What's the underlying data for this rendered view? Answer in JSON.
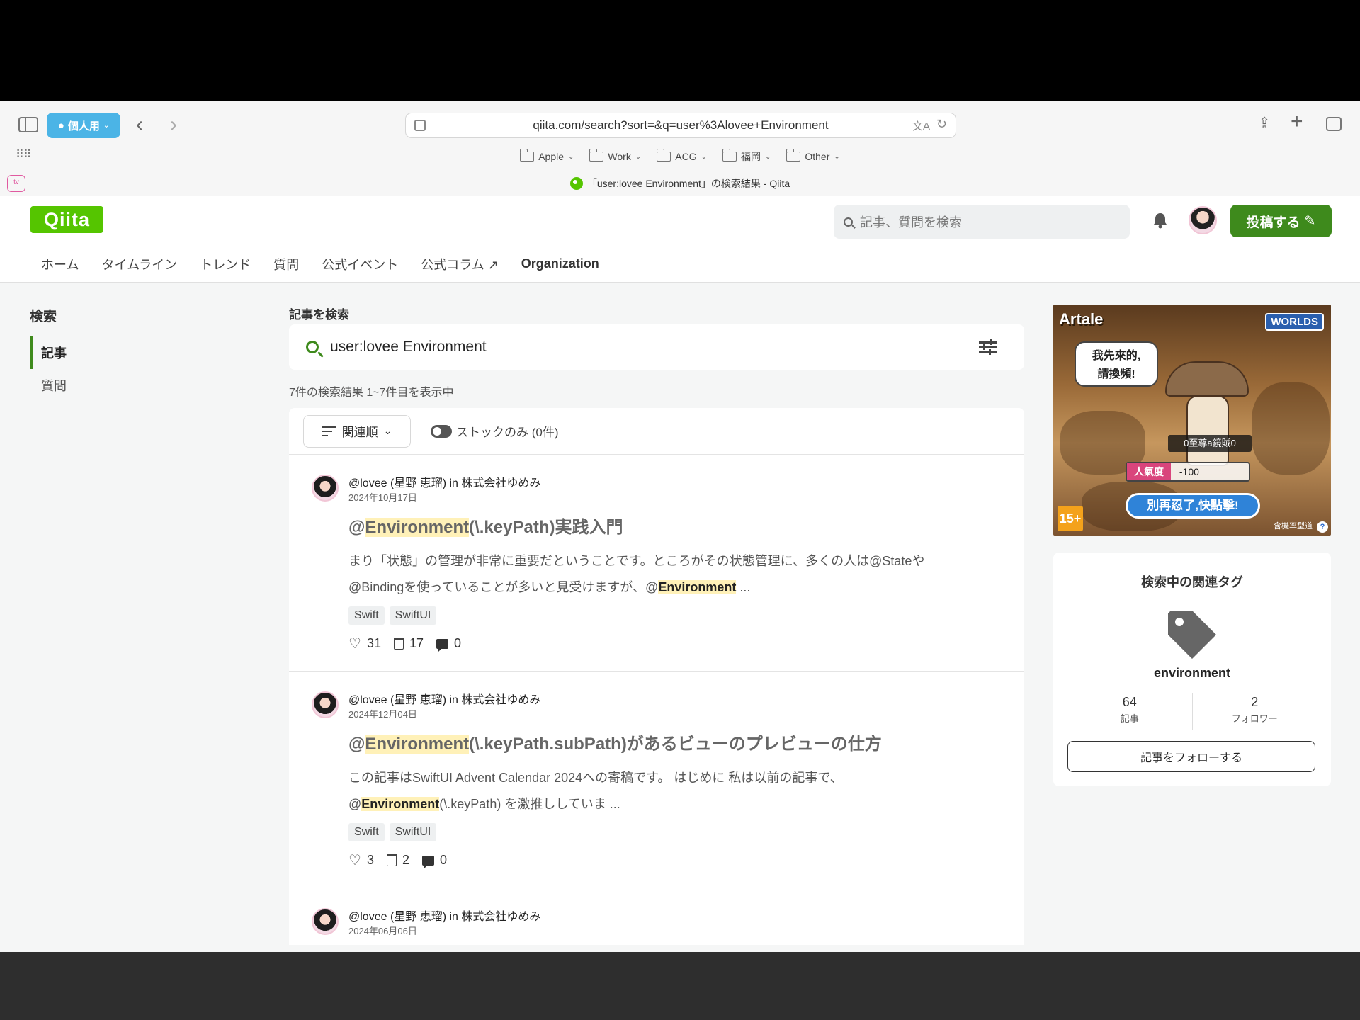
{
  "browser": {
    "profile_label": "個人用",
    "url": "qiita.com/search?sort=&q=user%3Alovee+Environment",
    "bookmarks": [
      {
        "label": "Apple"
      },
      {
        "label": "Work"
      },
      {
        "label": "ACG"
      },
      {
        "label": "福岡"
      },
      {
        "label": "Other"
      }
    ],
    "tab_title": "「user:lovee Environment」の検索結果 - Qiita",
    "pinned_tab_label": "tv"
  },
  "header": {
    "logo": "Qiita",
    "search_placeholder": "記事、質問を検索",
    "post_button": "投稿する"
  },
  "nav": {
    "items": [
      "ホーム",
      "タイムライン",
      "トレンド",
      "質問",
      "公式イベント",
      "公式コラム",
      "Organization"
    ]
  },
  "left_nav": {
    "title": "検索",
    "items": [
      {
        "label": "記事",
        "active": true
      },
      {
        "label": "質問",
        "active": false
      }
    ]
  },
  "search": {
    "section_label": "記事を検索",
    "query": "user:lovee Environment",
    "result_count": "7件の検索結果  1~7件目を表示中",
    "sort_label": "関連順",
    "stock_only_label": "ストックのみ (0件)"
  },
  "articles": [
    {
      "author": "@lovee (星野 恵瑠) in 株式会社ゆめみ",
      "date": "2024年10月17日",
      "title_prefix": "@",
      "title_highlight": "Environment",
      "title_suffix": "(\\.keyPath)実践入門",
      "body_line1": "まり「状態」の管理が非常に重要だということです。ところがその状態管理に、多くの人は@Stateや",
      "body_line2_prefix": "@Bindingを使っていることが多いと見受けますが、@",
      "body_line2_highlight": "Environment",
      "body_line2_suffix": " ...",
      "tags": [
        "Swift",
        "SwiftUI"
      ],
      "likes": "31",
      "stocks": "17",
      "comments": "0"
    },
    {
      "author": "@lovee (星野 恵瑠) in 株式会社ゆめみ",
      "date": "2024年12月04日",
      "title_prefix": "@",
      "title_highlight": "Environment",
      "title_suffix": "(\\.keyPath.subPath)があるビューのプレビューの仕方",
      "body_line1": "この記事はSwiftUI Advent Calendar 2024への寄稿です。 はじめに 私は以前の記事で、",
      "body_line2_prefix": "@",
      "body_line2_highlight": "Environment",
      "body_line2_suffix": "(\\.keyPath) を激推ししていま ...",
      "tags": [
        "Swift",
        "SwiftUI"
      ],
      "likes": "3",
      "stocks": "2",
      "comments": "0"
    },
    {
      "author": "@lovee (星野 恵瑠) in 株式会社ゆめみ",
      "date": "2024年06月06日"
    }
  ],
  "ad": {
    "brand": "Artale",
    "platform": "WORLDS",
    "bubble_line1": "我先來的,",
    "bubble_line2": "請換頻!",
    "name_tag": "0至尊a鏡賊0",
    "popularity_label": "人氣度",
    "popularity_value": "-100",
    "cta": "別再忍了,快點擊!",
    "rating": "15+",
    "note": "含機率型道"
  },
  "related_tag": {
    "title": "検索中の関連タグ",
    "name": "environment",
    "articles_count": "64",
    "articles_label": "記事",
    "followers_count": "2",
    "followers_label": "フォロワー",
    "follow_button": "記事をフォローする"
  }
}
